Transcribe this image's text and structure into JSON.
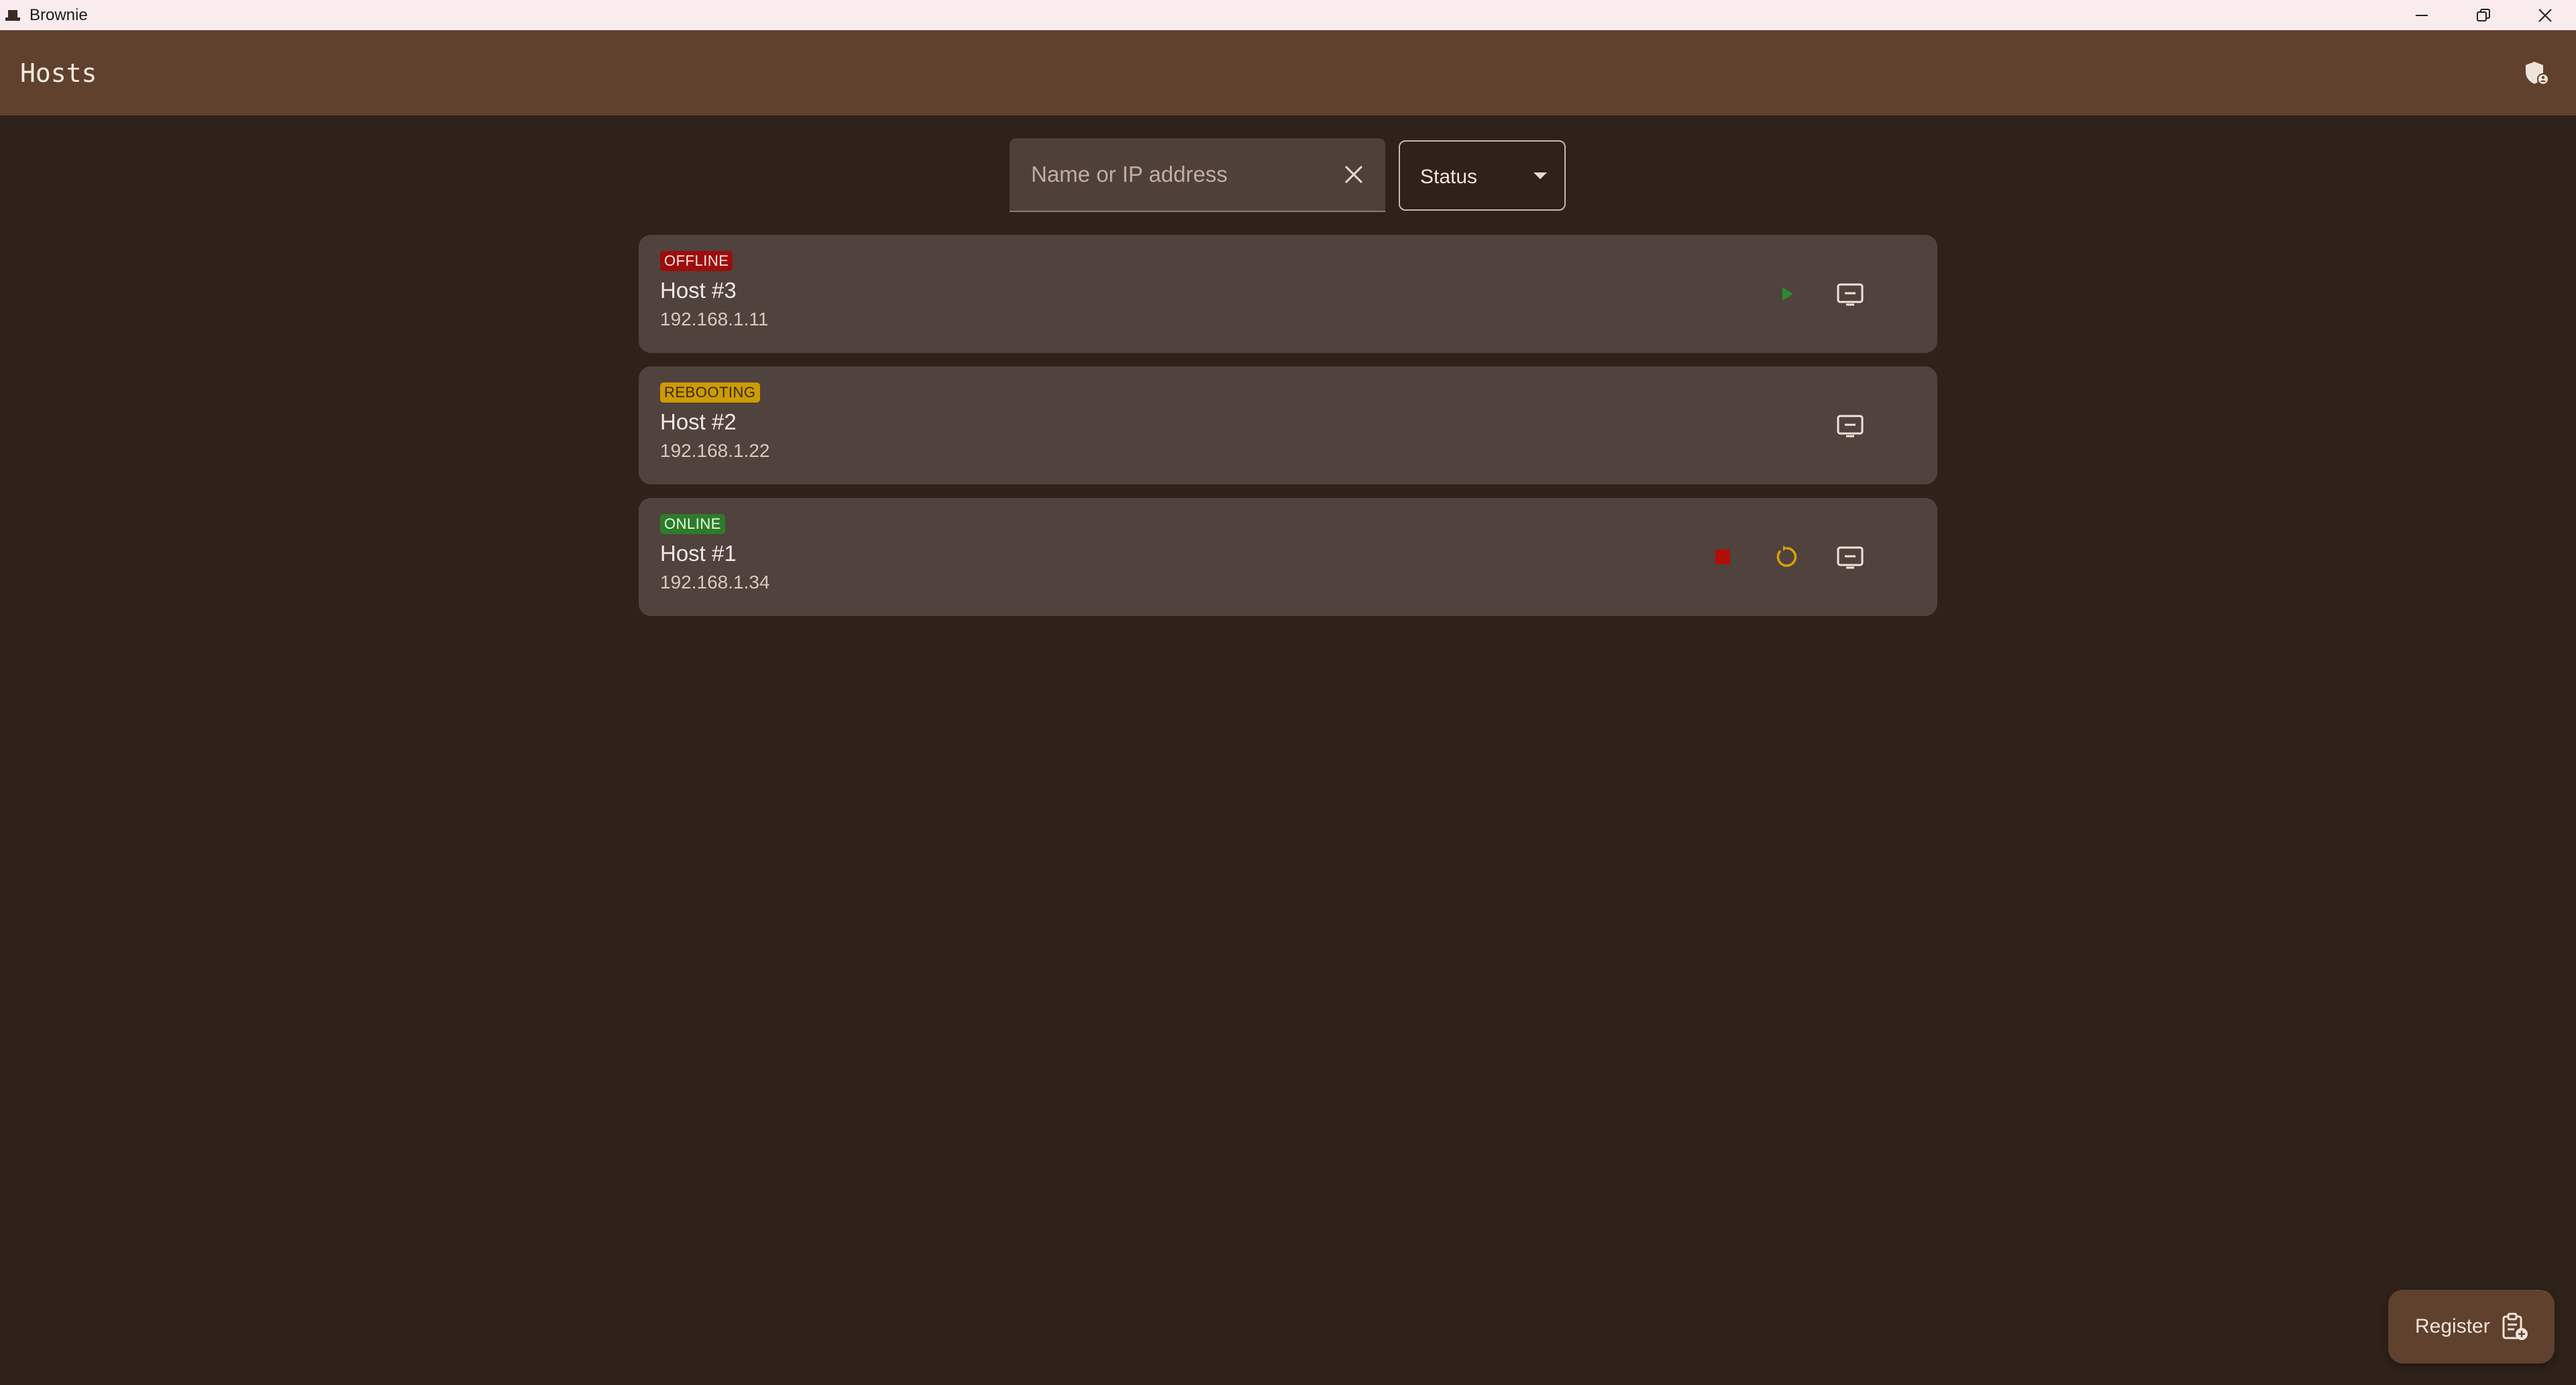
{
  "window": {
    "title": "Brownie",
    "icons": [
      "app-hat-icon",
      "minimize-icon",
      "restore-icon",
      "close-icon"
    ]
  },
  "appbar": {
    "title": "Hosts",
    "action_icon": "admin-shield-icon"
  },
  "filters": {
    "search_placeholder": "Name or IP address",
    "search_value": "",
    "status_label": "Status"
  },
  "hosts": [
    {
      "status": "OFFLINE",
      "name": "Host #3",
      "ip": "192.168.1.11",
      "actions": [
        "start-icon",
        "remote-screen-icon"
      ]
    },
    {
      "status": "REBOOTING",
      "name": "Host #2",
      "ip": "192.168.1.22",
      "actions": [
        "remote-screen-icon"
      ]
    },
    {
      "status": "ONLINE",
      "name": "Host #1",
      "ip": "192.168.1.34",
      "actions": [
        "stop-icon",
        "restart-icon",
        "remote-screen-icon"
      ]
    }
  ],
  "register": {
    "label": "Register",
    "icon": "register-clipboard-icon"
  },
  "colors": {
    "background": "#2e221b",
    "appbar": "#60412d",
    "card": "#50423c",
    "offline": "#9c0d0b",
    "rebooting": "#cd9b05",
    "online": "#2e7b2b"
  }
}
